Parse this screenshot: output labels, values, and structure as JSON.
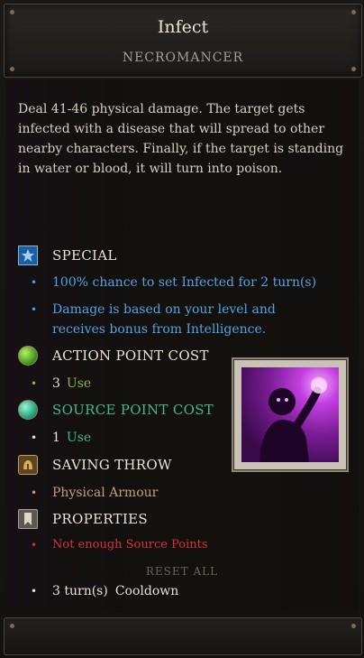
{
  "header": {
    "title": "Infect",
    "subtitle": "NECROMANCER"
  },
  "description": "Deal 41-46 physical damage. The target gets infected with a disease that will spread to other nearby characters. Finally, if the target is standing in water or blood, it will turn into poison.",
  "sections": {
    "special": {
      "label": "SPECIAL",
      "icon": "star-icon",
      "bullets": [
        "100% chance to set Infected for 2 turn(s)",
        "Damage is based on your level and receives bonus from Intelligence."
      ]
    },
    "action_point_cost": {
      "label": "ACTION POINT COST",
      "icon": "green-orb-icon",
      "value": "3",
      "unit": "Use"
    },
    "source_point_cost": {
      "label": "SOURCE POINT COST",
      "icon": "teal-orb-icon",
      "value": "1",
      "unit": "Use"
    },
    "saving_throw": {
      "label": "SAVING THROW",
      "icon": "helmet-icon",
      "value": "Physical Armour"
    },
    "properties": {
      "label": "PROPERTIES",
      "icon": "bookmark-icon",
      "value": "Not enough Source Points"
    }
  },
  "reset_label": "RESET ALL",
  "cooldown": {
    "value": "3 turn(s)",
    "label": "Cooldown"
  },
  "colors": {
    "special_text": "#4fa4e4",
    "green_label": "#e9e3d6",
    "green_value": "#8fb53b",
    "teal_label": "#3fb98d",
    "teal_value": "#3fb98d",
    "saving_value": "#c0a36d",
    "warning": "#d33535"
  },
  "portrait": {
    "icon": "infect-skill-portrait-icon"
  }
}
